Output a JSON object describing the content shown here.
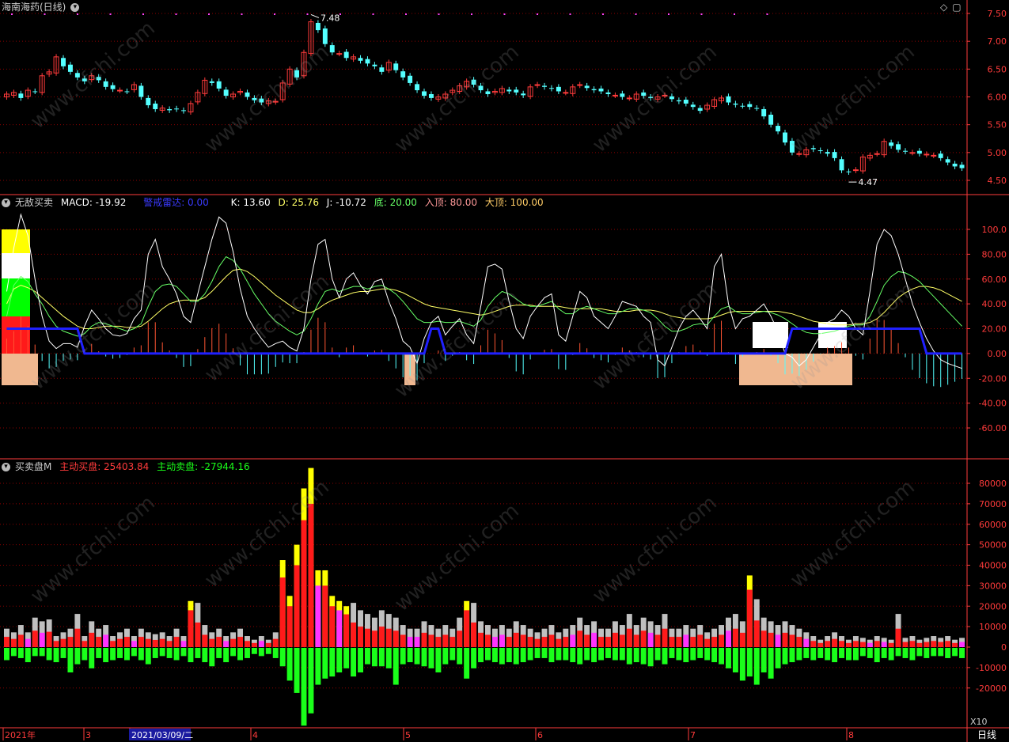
{
  "panel1": {
    "title": "海南海药(日线)",
    "high_label": "7.48",
    "low_label": "4.47",
    "yticks": [
      "7.50",
      "7.00",
      "6.50",
      "6.00",
      "5.50",
      "5.00",
      "4.50"
    ]
  },
  "panel2": {
    "name": "无敌买卖",
    "macd": "MACD: -19.92",
    "warn": "警戒雷达: 0.00",
    "k": "K: 13.60",
    "d": "D: 25.76",
    "j": "J: -10.72",
    "di": "底: 20.00",
    "ruding": "入顶: 80.00",
    "dading": "大顶: 100.00",
    "yticks": [
      "100.0",
      "80.00",
      "60.00",
      "40.00",
      "20.00",
      "0.00",
      "-20.00",
      "-40.00",
      "-60.00"
    ]
  },
  "panel3": {
    "name": "买卖盘M",
    "buy": "主动买盘: 25403.84",
    "sell": "主动卖盘: -27944.16",
    "yticks": [
      "80000",
      "70000",
      "60000",
      "50000",
      "40000",
      "30000",
      "20000",
      "10000",
      "0",
      "-10000",
      "-20000"
    ],
    "scale": "X10"
  },
  "xaxis": {
    "labels": [
      "2021年",
      "3",
      "2021/03/09/二",
      "4",
      "5",
      "6",
      "7",
      "8"
    ],
    "period": "日线"
  },
  "watermark": "www.cfchi.com",
  "colors": {
    "up": "#ff3b3b",
    "down": "#54ffff",
    "grid": "#8b0000",
    "axis": "#ff3b3b",
    "macd_bar": "#54ffff",
    "k": "#ffffff",
    "d": "#66ff66",
    "j": "#ffff66",
    "radar": "#0000ff",
    "buy": "#ff1a1a",
    "sell": "#1aff1a",
    "big": "#ffff00",
    "mid": "#c0c0c0",
    "alt": "#ff33ff",
    "salmon": "#f0b890"
  },
  "chart_data": [
    {
      "type": "candlestick",
      "title": "海南海药(日线)",
      "ylim": [
        4.4,
        7.6
      ],
      "close": [
        6.05,
        6.08,
        5.98,
        6.12,
        6.1,
        6.38,
        6.45,
        6.72,
        6.55,
        6.45,
        6.35,
        6.28,
        6.38,
        6.3,
        6.18,
        6.14,
        6.12,
        6.1,
        6.22,
        6.0,
        5.85,
        5.78,
        5.8,
        5.76,
        5.78,
        5.75,
        5.88,
        6.08,
        6.3,
        6.25,
        6.15,
        6.02,
        6.05,
        6.1,
        6.0,
        5.94,
        5.9,
        5.93,
        5.92,
        6.25,
        6.5,
        6.35,
        6.8,
        7.35,
        7.2,
        6.95,
        6.8,
        6.78,
        6.7,
        6.72,
        6.65,
        6.6,
        6.55,
        6.45,
        6.62,
        6.48,
        6.35,
        6.25,
        6.12,
        6.02,
        5.98,
        6.0,
        6.05,
        6.12,
        6.2,
        6.28,
        6.22,
        6.12,
        6.05,
        6.1,
        6.15,
        6.1,
        6.08,
        6.03,
        6.18,
        6.22,
        6.18,
        6.15,
        6.1,
        6.08,
        6.18,
        6.22,
        6.16,
        6.12,
        6.1,
        6.05,
        6.03,
        6.0,
        5.98,
        6.05,
        6.02,
        5.98,
        6.0,
        6.03,
        5.96,
        5.92,
        5.88,
        5.82,
        5.75,
        5.85,
        5.95,
        5.98,
        5.9,
        5.86,
        5.84,
        5.82,
        5.8,
        5.65,
        5.5,
        5.38,
        5.18,
        5.0,
        4.98,
        5.05,
        5.06,
        5.03,
        4.98,
        4.9,
        4.68,
        4.65,
        4.69,
        4.92,
        4.95,
        4.98,
        5.2,
        5.12,
        5.05,
        5.02,
        5.0,
        4.98,
        4.97,
        4.95,
        4.9,
        4.82,
        4.75,
        4.72
      ],
      "high_label": 7.48,
      "low_label": 4.47
    },
    {
      "type": "line",
      "series": [
        {
          "name": "K",
          "values": [
            50,
            85,
            112,
            95,
            60,
            30,
            10,
            4,
            8,
            8,
            5,
            22,
            35,
            28,
            20,
            15,
            14,
            16,
            28,
            35,
            80,
            92,
            70,
            60,
            48,
            30,
            25,
            48,
            70,
            92,
            110,
            105,
            82,
            52,
            30,
            20,
            12,
            5,
            8,
            10,
            5,
            2,
            20,
            60,
            88,
            92,
            60,
            45,
            60,
            65,
            55,
            48,
            58,
            60,
            42,
            28,
            10,
            5,
            -8,
            12,
            25,
            30,
            15,
            22,
            28,
            15,
            8,
            38,
            70,
            72,
            68,
            42,
            20,
            12,
            30,
            38,
            45,
            48,
            15,
            10,
            30,
            50,
            45,
            30,
            25,
            20,
            30,
            42,
            40,
            38,
            30,
            25,
            -5,
            -10,
            5,
            20,
            30,
            35,
            28,
            20,
            70,
            80,
            40,
            20,
            28,
            30,
            35,
            40,
            30,
            18,
            0,
            -3,
            -10,
            -5,
            5,
            15,
            25,
            28,
            35,
            30,
            20,
            15,
            50,
            88,
            100,
            95,
            80,
            60,
            40,
            25,
            12,
            2,
            -5,
            -8,
            -10,
            -12
          ]
        },
        {
          "name": "D",
          "values": [
            30,
            55,
            62,
            58,
            48,
            40,
            30,
            22,
            18,
            16,
            14,
            16,
            22,
            25,
            24,
            22,
            20,
            18,
            20,
            24,
            38,
            50,
            55,
            56,
            54,
            48,
            42,
            42,
            48,
            58,
            70,
            78,
            75,
            68,
            58,
            48,
            40,
            32,
            26,
            22,
            18,
            15,
            18,
            28,
            40,
            50,
            52,
            50,
            52,
            54,
            54,
            52,
            54,
            55,
            52,
            48,
            42,
            35,
            28,
            25,
            25,
            26,
            25,
            25,
            26,
            24,
            22,
            27,
            38,
            45,
            50,
            48,
            44,
            40,
            38,
            38,
            40,
            42,
            36,
            32,
            32,
            36,
            38,
            36,
            34,
            32,
            32,
            34,
            36,
            36,
            35,
            33,
            28,
            22,
            18,
            18,
            20,
            23,
            24,
            23,
            30,
            36,
            38,
            34,
            32,
            32,
            33,
            34,
            33,
            31,
            28,
            24,
            20,
            17,
            16,
            16,
            17,
            18,
            20,
            22,
            23,
            23,
            30,
            42,
            55,
            62,
            66,
            65,
            62,
            58,
            52,
            46,
            40,
            34,
            28,
            22
          ]
        },
        {
          "name": "J",
          "values": [
            40,
            52,
            55,
            53,
            50,
            45,
            40,
            35,
            30,
            26,
            22,
            20,
            20,
            21,
            22,
            22,
            22,
            21,
            21,
            22,
            26,
            31,
            36,
            40,
            42,
            43,
            43,
            43,
            45,
            50,
            56,
            62,
            67,
            68,
            66,
            62,
            57,
            52,
            47,
            43,
            39,
            35,
            33,
            33,
            36,
            40,
            43,
            45,
            47,
            49,
            50,
            50,
            51,
            52,
            52,
            51,
            49,
            46,
            43,
            40,
            38,
            37,
            36,
            35,
            34,
            33,
            32,
            31,
            32,
            34,
            36,
            38,
            39,
            39,
            39,
            38,
            38,
            38,
            38,
            37,
            36,
            36,
            36,
            36,
            36,
            35,
            34,
            34,
            34,
            35,
            35,
            35,
            34,
            32,
            30,
            29,
            28,
            28,
            28,
            28,
            29,
            31,
            33,
            34,
            34,
            34,
            34,
            34,
            34,
            34,
            33,
            32,
            30,
            28,
            26,
            25,
            24,
            23,
            23,
            23,
            24,
            24,
            25,
            28,
            33,
            39,
            45,
            49,
            52,
            54,
            54,
            53,
            51,
            48,
            45,
            42
          ]
        }
      ],
      "reference_lines": {
        "底": 20,
        "入顶": 80,
        "大顶": 100
      },
      "macd": {
        "name": "MACD",
        "last": -19.92
      },
      "warn_radar": {
        "name": "警戒雷达",
        "last": 0
      },
      "ylim": [
        -70,
        118
      ]
    },
    {
      "type": "bar",
      "title": "买卖盘M",
      "series": [
        {
          "name": "主动买盘",
          "values": [
            5000,
            4000,
            6000,
            4000,
            8000,
            7000,
            7500,
            3000,
            4000,
            5000,
            9000,
            3000,
            7000,
            5000,
            6000,
            3000,
            4000,
            5000,
            3000,
            5000,
            4000,
            3500,
            4000,
            3000,
            5000,
            3000,
            18000,
            12000,
            6000,
            4000,
            5000,
            3000,
            4000,
            5000,
            3000,
            2000,
            3000,
            2000,
            4000,
            34000,
            20000,
            40000,
            62000,
            70000,
            30000,
            30000,
            20000,
            18000,
            16000,
            12000,
            10000,
            9000,
            8000,
            10000,
            9000,
            8000,
            6000,
            5000,
            5000,
            7000,
            6000,
            5000,
            6000,
            5000,
            8000,
            18000,
            12000,
            7000,
            6000,
            5000,
            6000,
            5000,
            7000,
            6000,
            5000,
            4000,
            5000,
            6000,
            4000,
            5000,
            6000,
            8000,
            6000,
            7000,
            5000,
            5000,
            7000,
            6000,
            9000,
            6000,
            8000,
            7000,
            6000,
            9000,
            5000,
            5000,
            6000,
            5000,
            6000,
            4000,
            5000,
            6000,
            8000,
            9000,
            7000,
            28000,
            13000,
            8000,
            7000,
            6000,
            7000,
            6000,
            5000,
            4000,
            3000,
            2000,
            3000,
            4000,
            3000,
            2000,
            3000,
            2500,
            2000,
            3000,
            2500,
            2000,
            9000,
            2500,
            3000,
            2000,
            2500,
            3000,
            2500,
            3000,
            2000,
            2500
          ]
        },
        {
          "name": "主动卖盘",
          "values": [
            -6000,
            -4000,
            -5000,
            -7000,
            -4000,
            -4000,
            -6000,
            -7000,
            -5000,
            -12000,
            -8000,
            -6000,
            -10000,
            -5000,
            -7000,
            -6000,
            -5000,
            -6000,
            -4000,
            -6000,
            -8000,
            -5000,
            -4000,
            -5000,
            -6000,
            -4000,
            -7000,
            -5000,
            -7000,
            -9000,
            -5000,
            -7000,
            -4000,
            -6000,
            -5000,
            -3000,
            -4000,
            -3000,
            -5000,
            -9000,
            -16000,
            -22000,
            -38000,
            -32000,
            -18000,
            -15000,
            -14000,
            -12000,
            -10000,
            -14000,
            -12000,
            -8000,
            -9000,
            -9000,
            -10000,
            -18000,
            -8000,
            -7000,
            -8000,
            -9000,
            -10000,
            -12000,
            -8000,
            -6000,
            -8000,
            -15000,
            -10000,
            -7000,
            -6000,
            -7000,
            -8000,
            -7000,
            -8000,
            -7000,
            -6000,
            -5000,
            -5000,
            -7000,
            -6000,
            -6000,
            -7000,
            -8000,
            -6000,
            -7000,
            -6000,
            -5000,
            -6000,
            -6000,
            -8000,
            -7000,
            -8000,
            -9000,
            -6000,
            -8000,
            -5000,
            -6000,
            -7000,
            -6000,
            -5000,
            -6000,
            -7000,
            -8000,
            -10000,
            -12000,
            -16000,
            -14000,
            -18000,
            -12000,
            -15000,
            -10000,
            -8000,
            -7000,
            -6000,
            -5000,
            -6000,
            -5000,
            -6000,
            -7000,
            -5000,
            -6000,
            -6000,
            -4000,
            -5000,
            -7000,
            -5000,
            -6000,
            -4000,
            -5000,
            -6000,
            -4000,
            -5000,
            -4000,
            -4000,
            -5000,
            -4000,
            -5000
          ]
        }
      ],
      "ylim": [
        -36000,
        90000
      ]
    }
  ]
}
